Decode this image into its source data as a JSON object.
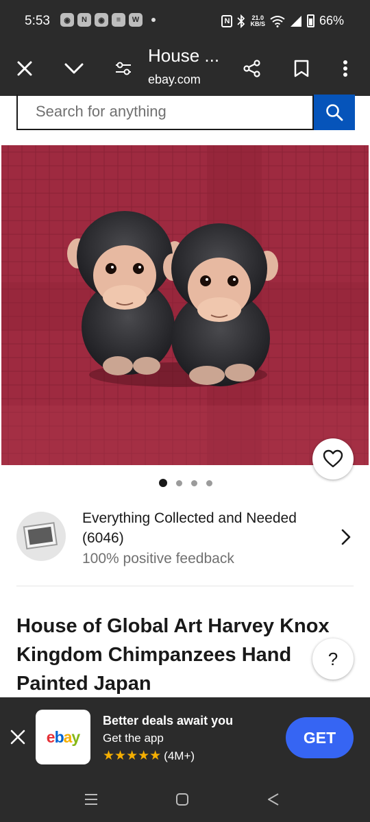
{
  "status_bar": {
    "time": "5:53",
    "net_speed_value": "21.0",
    "net_speed_unit": "KB/S",
    "battery": "66%",
    "notification_icons": [
      "app-icon",
      "app-icon",
      "app-icon",
      "app-icon",
      "W"
    ]
  },
  "toolbar": {
    "tab_title": "House ...",
    "url": "ebay.com",
    "icons": [
      "close-icon",
      "chevron-down-icon",
      "tune-icon",
      "share-icon",
      "bookmark-icon",
      "more-vert-icon"
    ]
  },
  "search": {
    "placeholder": "Search for anything"
  },
  "gallery": {
    "image_count": 4,
    "active_index": 0
  },
  "seller": {
    "name": "Everything Collected and Needed",
    "feedback_count": "(6046)",
    "feedback_percent": "100% positive feedback"
  },
  "item": {
    "title": "House of Global Art Harvey Knox Kingdom Chimpanzees Hand Painted Japan"
  },
  "help": {
    "label": "?"
  },
  "app_banner": {
    "logo_letters": [
      "e",
      "b",
      "a",
      "y"
    ],
    "logo_colors": [
      "#e53238",
      "#0064d2",
      "#f5af02",
      "#86b817"
    ],
    "headline": "Better deals await you",
    "subtext": "Get the app",
    "stars": "★★★★★",
    "rating_count": "(4M+)",
    "cta": "GET"
  },
  "colors": {
    "system_bar": "#2b2b2b",
    "search_button": "#0654ba",
    "get_button": "#3665f3",
    "star": "#f5af02",
    "text_primary": "#191919",
    "text_secondary": "#707070"
  }
}
